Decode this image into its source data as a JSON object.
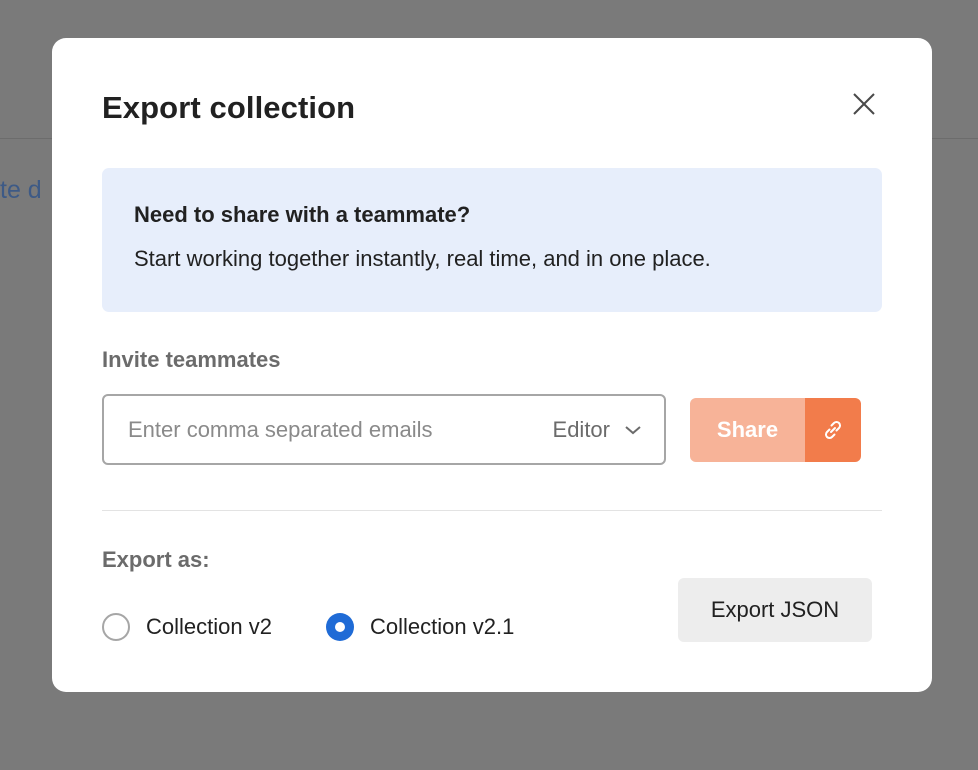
{
  "background": {
    "partial_link_text": "te d"
  },
  "modal": {
    "title": "Export collection",
    "close_icon": "close-icon",
    "banner": {
      "heading": "Need to share with a teammate?",
      "body": "Start working together instantly, real time, and in one place."
    },
    "invite": {
      "label": "Invite teammates",
      "email_placeholder": "Enter comma separated emails",
      "email_value": "",
      "role_selected": "Editor",
      "role_icon": "chevron-down-icon",
      "share_label": "Share",
      "share_link_icon": "link-icon"
    },
    "export": {
      "label": "Export as:",
      "options": [
        {
          "label": "Collection v2",
          "selected": false
        },
        {
          "label": "Collection v2.1",
          "selected": true
        }
      ],
      "button_label": "Export JSON"
    }
  },
  "colors": {
    "overlay": "#7a7a7a",
    "banner_bg": "#e7eefb",
    "share_button": "#f7b398",
    "share_link_button": "#f27c4b",
    "radio_selected": "#1f6bd6",
    "export_button_bg": "#ededed"
  }
}
